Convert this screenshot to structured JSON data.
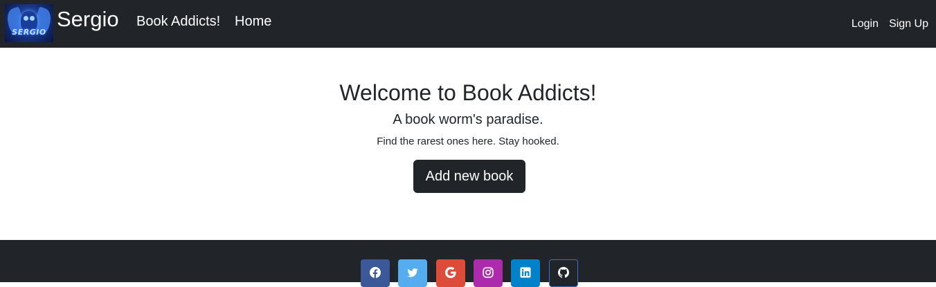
{
  "navbar": {
    "brand": "Sergio",
    "logo_text": "SERGIO",
    "links": [
      {
        "label": "Book Addicts!"
      },
      {
        "label": "Home"
      }
    ],
    "right_links": [
      {
        "label": "Login"
      },
      {
        "label": "Sign Up"
      }
    ]
  },
  "hero": {
    "title": "Welcome to Book Addicts!",
    "subtitle": "A book worm's paradise.",
    "tagline": "Find the rarest ones here. Stay hooked.",
    "button_label": "Add new book"
  },
  "footer": {
    "social": [
      {
        "icon": "facebook-icon",
        "color": "#3b5998"
      },
      {
        "icon": "twitter-icon",
        "color": "#55acee"
      },
      {
        "icon": "google-icon",
        "color": "#dd4b39"
      },
      {
        "icon": "instagram-icon",
        "color": "#ac2bac"
      },
      {
        "icon": "linkedin-icon",
        "color": "#0082ca"
      },
      {
        "icon": "github-icon",
        "color": "#212529"
      }
    ]
  },
  "colors": {
    "dark": "#212529",
    "white": "#ffffff"
  }
}
